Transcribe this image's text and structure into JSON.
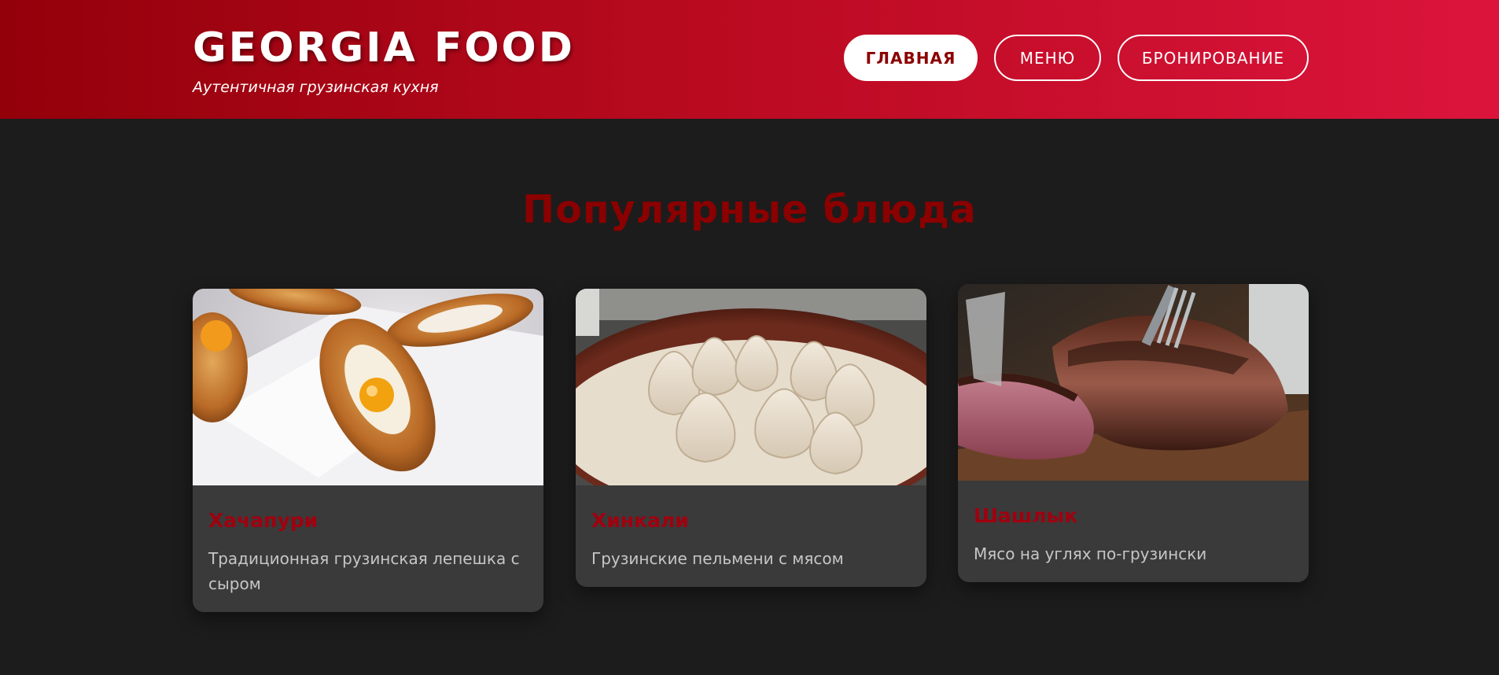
{
  "header": {
    "logo": "GEORGIA FOOD",
    "tagline": "Аутентичная грузинская кухня",
    "nav": {
      "home": "ГЛАВНАЯ",
      "menu": "МЕНЮ",
      "booking": "БРОНИРОВАНИЕ"
    }
  },
  "main": {
    "section_title": "Популярные блюда",
    "dishes": [
      {
        "title": "Хачапури",
        "description": "Традиционная грузинская лепешка с сыром",
        "image": "khachapuri-photo"
      },
      {
        "title": "Хинкали",
        "description": "Грузинские пельмени с мясом",
        "image": "khinkali-photo"
      },
      {
        "title": "Шашлык",
        "description": "Мясо на углях по-грузински",
        "image": "shashlik-photo"
      }
    ]
  },
  "colors": {
    "header_gradient_start": "#93000a",
    "header_gradient_end": "#dc143c",
    "accent": "#8b0000",
    "background": "#1c1c1c",
    "card": "#3a3a3a"
  }
}
